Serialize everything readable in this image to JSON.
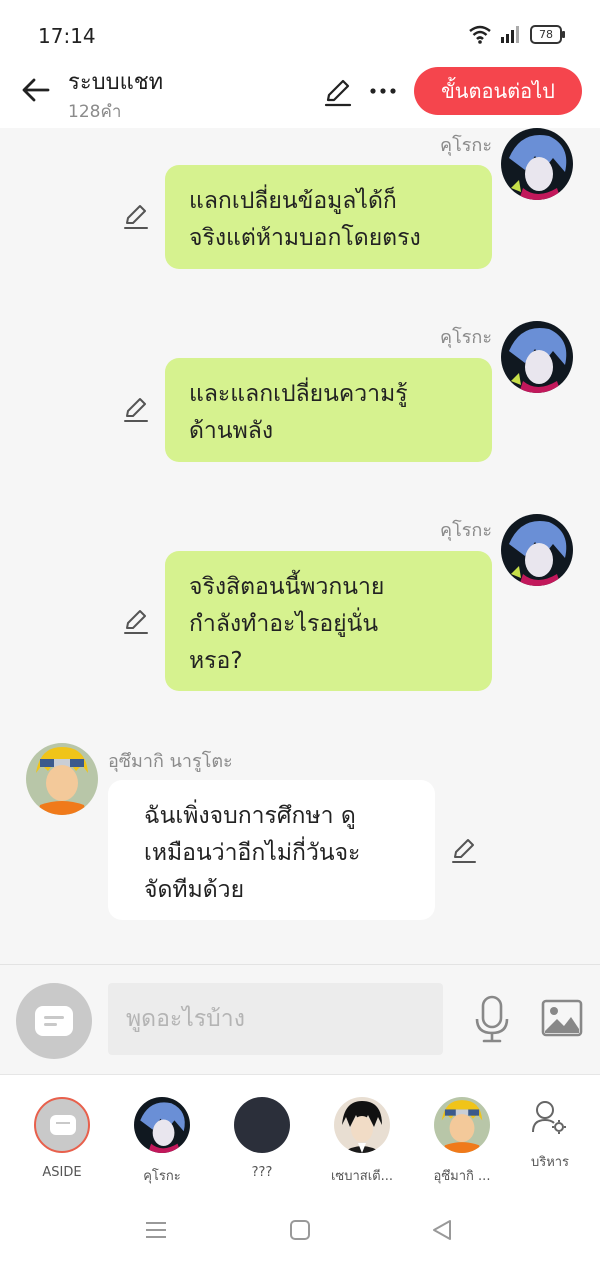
{
  "status_bar": {
    "time": "17:14",
    "battery": "78"
  },
  "header": {
    "title": "ระบบแชท",
    "word_count": "128คำ",
    "next_button": "ขั้นตอนต่อไป"
  },
  "messages": [
    {
      "sender": "คุโรกะ",
      "side": "right",
      "lines": [
        "แลกเปลี่ยนข้อมูลได้ก็",
        "จริงแต่ห้ามบอกโดยตรง"
      ]
    },
    {
      "sender": "คุโรกะ",
      "side": "right",
      "lines": [
        "และแลกเปลี่ยนความรู้",
        "ด้านพลัง"
      ]
    },
    {
      "sender": "คุโรกะ",
      "side": "right",
      "lines": [
        "จริงสิตอนนี้พวกนาย",
        "กำลังทำอะไรอยู่นั่น",
        "หรอ?"
      ]
    },
    {
      "sender": "อุซึมากิ นารูโตะ",
      "side": "left",
      "lines": [
        "ฉันเพิ่งจบการศึกษา ดู",
        "เหมือนว่าอีกไม่กี่วันจะ",
        "จัดทีมด้วย"
      ]
    }
  ],
  "composer": {
    "placeholder": "พูดอะไรบ้าง"
  },
  "characters": [
    {
      "label": "ASIDE"
    },
    {
      "label": "คุโรกะ"
    },
    {
      "label": "???"
    },
    {
      "label": "เซบาสเตี..."
    },
    {
      "label": "อุซึมากิ ..."
    },
    {
      "label": "บริหาร"
    }
  ],
  "colors": {
    "accent": "#f5454d",
    "bubble_right": "#d6f28f",
    "bubble_left": "#ffffff"
  }
}
